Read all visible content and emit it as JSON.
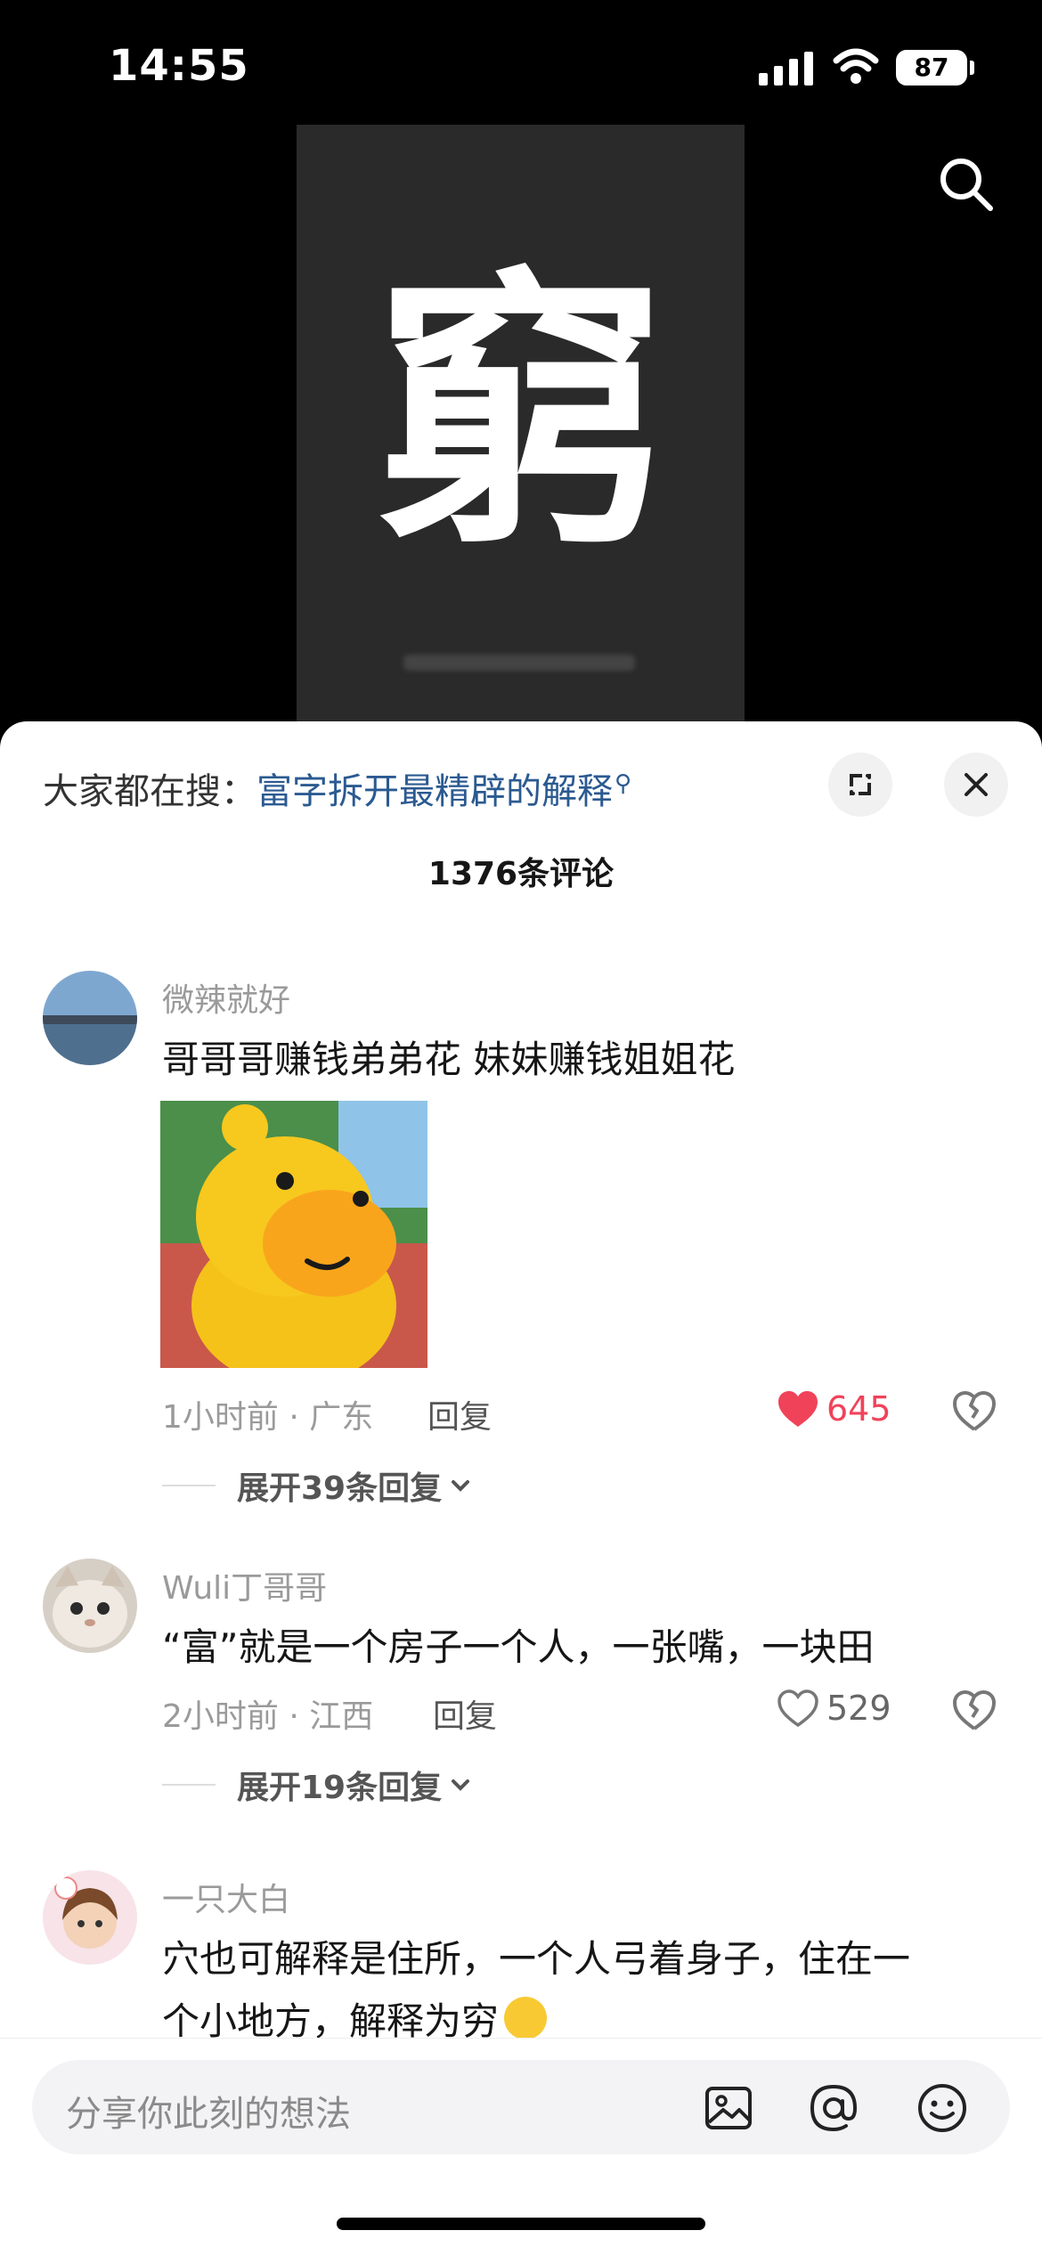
{
  "status_bar": {
    "time": "14:55",
    "battery": "87",
    "icons": [
      "signal-icon",
      "wifi-icon",
      "battery-icon"
    ]
  },
  "video": {
    "glyph": "窮",
    "actions": [
      "search-icon"
    ]
  },
  "sheet": {
    "hot_search_label": "大家都在搜：",
    "hot_search_query": "富字拆开最精辟的解释",
    "hot_search_icon": "search-icon",
    "comment_count": "1376条评论",
    "header_buttons": [
      "expand-icon",
      "close-icon"
    ]
  },
  "comments": [
    {
      "username": "微辣就好",
      "text": "哥哥哥赚钱弟弟花 妹妹赚钱姐姐花",
      "has_sticker": true,
      "meta": "1小时前 · 广东",
      "reply_label": "回复",
      "likes": "645",
      "liked": true,
      "expand_label": "展开39条回复"
    },
    {
      "username": "Wuli丁哥哥",
      "text": "“富”就是一个房子一个人，一张嘴，一块田",
      "has_sticker": false,
      "meta": "2小时前 · 江西",
      "reply_label": "回复",
      "likes": "529",
      "liked": false,
      "expand_label": "展开19条回复"
    },
    {
      "username": "一只大白",
      "text_line1": "穴也可解释是住所，一个人弓着身子，住在一",
      "text_line2": "个小地方，解释为穷"
    }
  ],
  "composer": {
    "placeholder": "分享你此刻的想法",
    "icons": [
      "image-icon",
      "at-icon",
      "emoji-icon"
    ]
  },
  "colors": {
    "like_red": "#f0435a",
    "link_blue": "#2b5a91"
  }
}
